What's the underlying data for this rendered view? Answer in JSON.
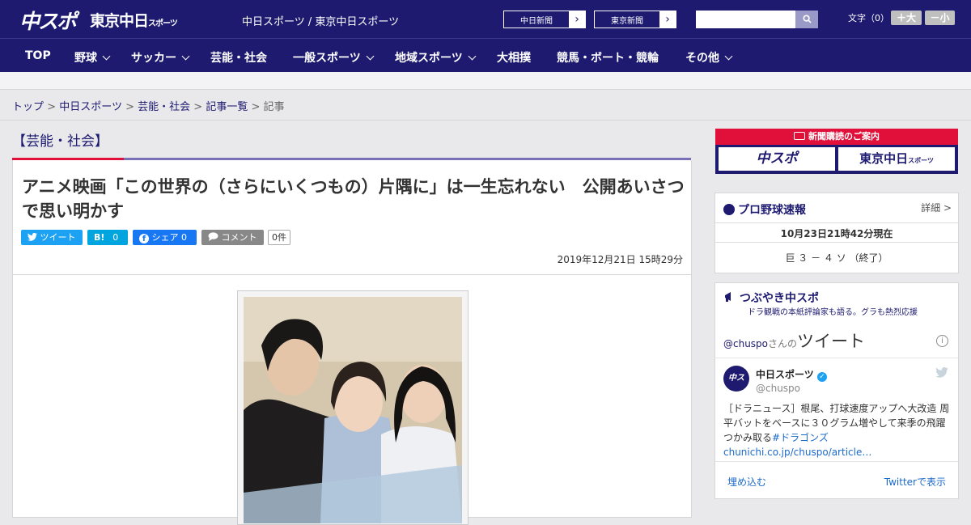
{
  "header": {
    "logo_chuspo": "中スポ",
    "logo_tokyo": "東京中日",
    "logo_tokyo_sub": "スポーツ",
    "site_name": "中日スポーツ / 東京中日スポーツ",
    "paper_links": [
      "中日新聞",
      "東京中日スポーツ"
    ],
    "paper_link_1": "中日新聞",
    "paper_link_2": "東京新聞",
    "search_placeholder": "",
    "font_size_label": "文字（0）",
    "font_larger": "＋大",
    "font_smaller": "－小"
  },
  "nav": {
    "items": [
      "TOP",
      "野球",
      "サッカー",
      "芸能・社会",
      "一般スポーツ",
      "地域スポーツ",
      "大相撲",
      "競馬・ボート・競輪",
      "その他"
    ]
  },
  "breadcrumb": {
    "top": "トップ",
    "sep": ">",
    "chunichi": "中日スポーツ",
    "category": "芸能・社会",
    "list": "記事一覧",
    "current": "記事"
  },
  "article": {
    "category": "【芸能・社会】",
    "title": "アニメ映画「この世界の（さらにいくつもの）片隅に」は一生忘れない　公開あいさつで思い明かす",
    "share_tweet": "ツイート",
    "share_hatena": "B!",
    "share_hatena_count": "0",
    "share_fb": "シェア",
    "share_fb_count": "0",
    "share_comment": "コメント",
    "comment_count": "0件",
    "date": "2019年12月21日 15時29分"
  },
  "sidebar": {
    "ad_title": "新聞購読のご案内",
    "ad_chuspo": "中スポ",
    "ad_tokyo": "東京中日",
    "ad_tokyo_sub": "スポーツ",
    "baseball_title": "プロ野球速報",
    "baseball_detail": "詳細 >",
    "baseball_time": "10月23日21時42分現在",
    "baseball_score": "巨 ３ － ４ ソ （終了）",
    "tsubuyaki_title": "つぶやき中スポ",
    "tsubuyaki_sub": "ドラ観戦の本紙評論家も語る。グラも熱烈応援",
    "tw_handle_line_1": "@chuspo",
    "tw_handle_line_2": "さんの",
    "tw_tweet_word": "ツイート",
    "tw_user": "中日スポーツ",
    "tw_screen": "@chuspo",
    "tw_text": "［ドラニュース］根尾、打球速度アップへ大改造 周平バットをベースに３０グラム増やして来季の飛躍つかみ取る",
    "tw_hashtag": "#ドラゴンズ",
    "tw_link": "chunichi.co.jp/chuspo/article…",
    "tw_embed": "埋め込む",
    "tw_view": "Twitterで表示"
  },
  "colors": {
    "brand": "#1d1a70",
    "accent": "#e0103a",
    "twitter": "#1da1f2",
    "hatena": "#00a4de",
    "facebook": "#1877f2"
  }
}
